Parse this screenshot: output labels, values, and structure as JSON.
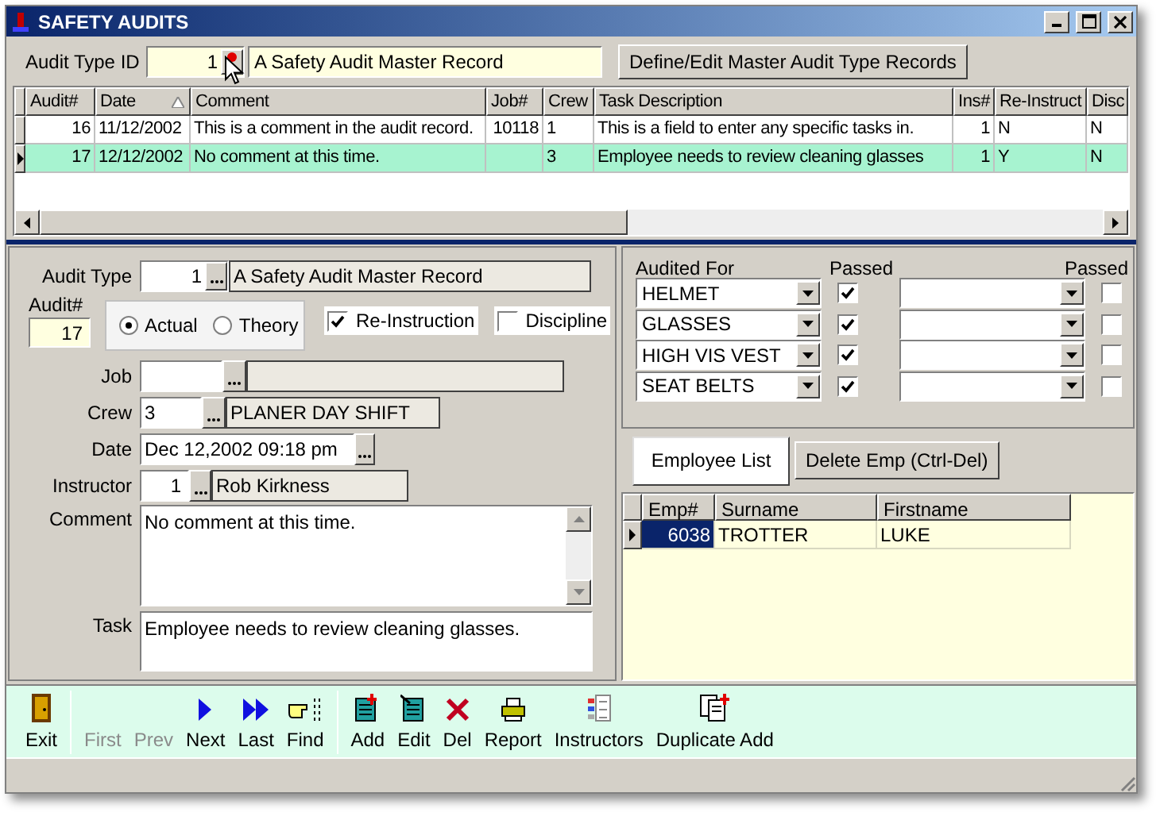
{
  "window": {
    "title": "SAFETY AUDITS"
  },
  "header": {
    "label": "Audit Type ID",
    "value": "1",
    "name": "A Safety Audit Master Record",
    "button": "Define/Edit Master Audit Type Records"
  },
  "grid": {
    "columns": [
      {
        "label": "Audit#",
        "sorted": false
      },
      {
        "label": "Date",
        "sorted": true
      },
      {
        "label": "Comment",
        "sorted": false
      },
      {
        "label": "Job#",
        "sorted": false
      },
      {
        "label": "Crew",
        "sorted": false
      },
      {
        "label": "Task Description",
        "sorted": false
      },
      {
        "label": "Ins#",
        "sorted": false
      },
      {
        "label": "Re-Instruct",
        "sorted": false
      },
      {
        "label": "Disc",
        "sorted": false
      }
    ],
    "rows": [
      {
        "selected": false,
        "cells": [
          "16",
          "11/12/2002",
          "This is a comment in the audit record.",
          "10118",
          "1",
          "This is a field to enter any specific tasks in.",
          "1",
          "N",
          "N"
        ]
      },
      {
        "selected": true,
        "cells": [
          "17",
          "12/12/2002",
          "No comment at this time.",
          "",
          "3",
          "Employee needs to review cleaning glasses",
          "1",
          "Y",
          "N"
        ]
      }
    ]
  },
  "form": {
    "audit_type": {
      "label": "Audit Type",
      "value": "1",
      "name": "A Safety Audit Master Record"
    },
    "audit_no": {
      "label": "Audit#",
      "value": "17"
    },
    "mode": [
      {
        "label": "Actual",
        "selected": true
      },
      {
        "label": "Theory",
        "selected": false
      }
    ],
    "flags": [
      {
        "label": "Re-Instruction",
        "checked": true
      },
      {
        "label": "Discipline",
        "checked": false
      }
    ],
    "job": {
      "label": "Job"
    },
    "crew": {
      "label": "Crew",
      "value": "3",
      "name": "PLANER DAY SHIFT"
    },
    "date": {
      "label": "Date",
      "value": "Dec 12,2002 09:18 pm"
    },
    "instructor": {
      "label": "Instructor",
      "value": "1",
      "name": "Rob Kirkness"
    },
    "comment": {
      "label": "Comment",
      "value": "No comment at this time."
    },
    "task": {
      "label": "Task",
      "value": "Employee needs to review cleaning glasses."
    }
  },
  "audited": {
    "label": "Audited For",
    "passed_labels": [
      "Passed",
      "Passed"
    ],
    "rows": [
      {
        "left": {
          "value": "HELMET",
          "passed": true
        },
        "right": {
          "passed": false
        }
      },
      {
        "left": {
          "value": "GLASSES",
          "passed": true
        },
        "right": {
          "passed": false
        }
      },
      {
        "left": {
          "value": "HIGH VIS VEST",
          "passed": true
        },
        "right": {
          "passed": false
        }
      },
      {
        "left": {
          "value": "SEAT BELTS",
          "passed": true
        },
        "right": {
          "passed": false
        }
      }
    ]
  },
  "employees": {
    "buttons": [
      "Employee List",
      "Delete Emp (Ctrl-Del)"
    ],
    "columns": [
      "Emp#",
      "Surname",
      "Firstname"
    ],
    "rows": [
      {
        "selected": true,
        "cells": [
          "6038",
          "TROTTER",
          "LUKE"
        ]
      }
    ]
  },
  "toolbar": {
    "groups": [
      [
        {
          "label": "Exit",
          "disabled": false
        }
      ],
      [
        {
          "label": "First",
          "disabled": true
        },
        {
          "label": "Prev",
          "disabled": true
        },
        {
          "label": "Next",
          "disabled": false
        },
        {
          "label": "Last",
          "disabled": false
        },
        {
          "label": "Find",
          "disabled": false
        }
      ],
      [
        {
          "label": "Add",
          "disabled": false
        },
        {
          "label": "Edit",
          "disabled": false
        },
        {
          "label": "Del",
          "disabled": false
        },
        {
          "label": "Report",
          "disabled": false
        },
        {
          "label": "Instructors",
          "disabled": false
        },
        {
          "label": "Duplicate Add",
          "disabled": false
        }
      ]
    ]
  }
}
